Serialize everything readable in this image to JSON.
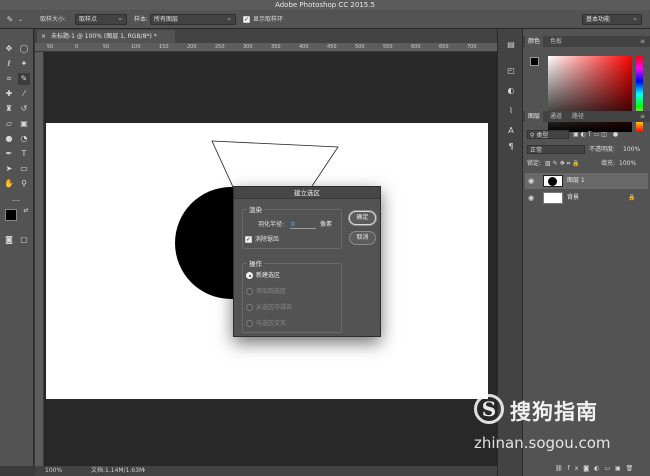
{
  "window": {
    "title": "Adobe Photoshop CC 2015.5"
  },
  "options_bar": {
    "sample_size_label": "取样大小:",
    "sample_size_value": "取样点",
    "sample_label": "样本:",
    "sample_value": "所有图层",
    "show_ring_label": "显示取样环",
    "workspace_value": "基本功能"
  },
  "document": {
    "tab_title": "未标题-1 @ 100% (图层 1, RGB/8*) *",
    "ruler_ticks": [
      "50",
      "0",
      "50",
      "100",
      "150",
      "200",
      "250",
      "300",
      "350",
      "400",
      "450",
      "500",
      "550",
      "600",
      "650",
      "700"
    ],
    "zoom": "100%",
    "doc_info": "文档:1.14M/1.63M"
  },
  "panels": {
    "color_tabs": [
      "颜色",
      "色板"
    ],
    "layer_tabs": [
      "图层",
      "通道",
      "路径"
    ],
    "filter_label": "类型",
    "blend_mode": "正常",
    "opacity_label": "不透明度:",
    "opacity_value": "100%",
    "lock_label": "锁定:",
    "fill_label": "填充:",
    "fill_value": "100%",
    "layers": [
      {
        "name": "图层 1"
      },
      {
        "name": "背景"
      }
    ]
  },
  "dialog": {
    "title": "建立选区",
    "render_group": "渲染",
    "feather_label": "羽化半径:",
    "feather_value": "0",
    "feather_unit": "像素",
    "antialias_label": "消除锯齿",
    "ok_label": "确定",
    "cancel_label": "取消",
    "operation_group": "操作",
    "operations": [
      "新建选区",
      "添加到选区",
      "从选区中减去",
      "与选区交叉"
    ]
  },
  "watermark": {
    "brand": "搜狗指南",
    "url": "zhinan.sogou.com"
  },
  "colors": {
    "foreground": "#000000",
    "background": "#ffffff",
    "workspace": "#282828",
    "panel": "#535353"
  }
}
